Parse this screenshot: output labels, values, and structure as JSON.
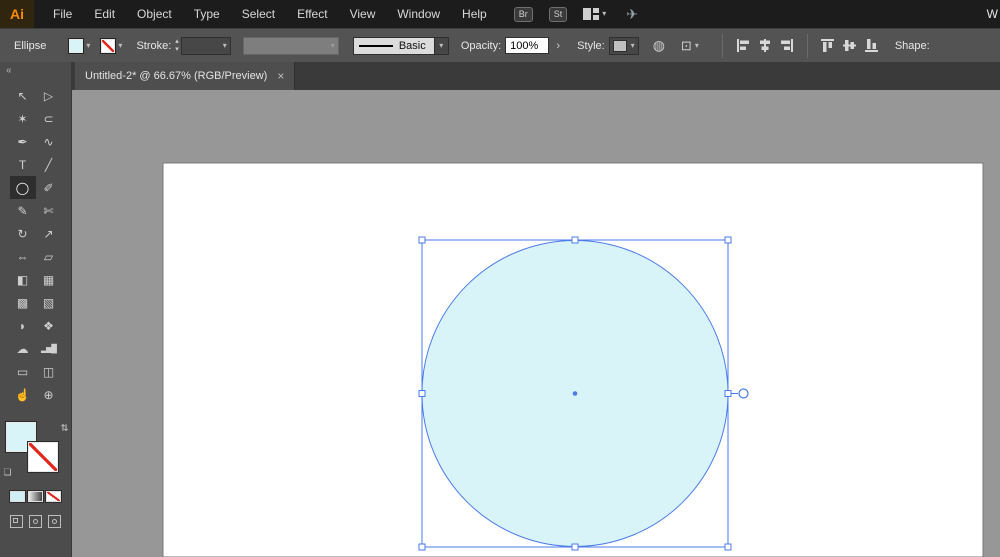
{
  "colors": {
    "accent_fill": "#d9f4f9",
    "selection_blue": "#4b7bec",
    "stroke_none_red": "#e0281c"
  },
  "menubar": {
    "logo": "Ai",
    "items": [
      "File",
      "Edit",
      "Object",
      "Type",
      "Select",
      "Effect",
      "View",
      "Window",
      "Help"
    ],
    "bridge_button": "Br",
    "stock_button": "St",
    "right_partial": "W"
  },
  "controlbar": {
    "tool_name": "Ellipse",
    "stroke_label": "Stroke:",
    "stroke_width_value": "",
    "brush_value": "Basic",
    "opacity_label": "Opacity:",
    "opacity_value": "100%",
    "style_label": "Style:",
    "shape_label": "Shape:"
  },
  "tabbar": {
    "title": "Untitled-2* @ 66.67% (RGB/Preview)",
    "close": "×"
  },
  "toolbar": {
    "collapse": "«",
    "tools": [
      {
        "name": "selection",
        "glyph": "↖"
      },
      {
        "name": "direct-selection",
        "glyph": "▷"
      },
      {
        "name": "magic-wand",
        "glyph": "✶"
      },
      {
        "name": "lasso",
        "glyph": "⊂"
      },
      {
        "name": "pen",
        "glyph": "✒"
      },
      {
        "name": "curvature",
        "glyph": "∿"
      },
      {
        "name": "type",
        "glyph": "T"
      },
      {
        "name": "line-segment",
        "glyph": "╱"
      },
      {
        "name": "ellipse",
        "glyph": "◯"
      },
      {
        "name": "paintbrush",
        "glyph": "✐"
      },
      {
        "name": "pencil",
        "glyph": "✎"
      },
      {
        "name": "scissors",
        "glyph": "✄"
      },
      {
        "name": "rotate",
        "glyph": "↻"
      },
      {
        "name": "scale",
        "glyph": "↗"
      },
      {
        "name": "width",
        "glyph": "⇔"
      },
      {
        "name": "free-transform",
        "glyph": "▱"
      },
      {
        "name": "shape-builder",
        "glyph": "◧"
      },
      {
        "name": "perspective-grid",
        "glyph": "▦"
      },
      {
        "name": "mesh",
        "glyph": "▩"
      },
      {
        "name": "gradient",
        "glyph": "▧"
      },
      {
        "name": "eyedropper",
        "glyph": "◗"
      },
      {
        "name": "blend",
        "glyph": "❖"
      },
      {
        "name": "symbol-sprayer",
        "glyph": "☁"
      },
      {
        "name": "column-graph",
        "glyph": "▂▅█"
      },
      {
        "name": "artboard",
        "glyph": "▭"
      },
      {
        "name": "slice",
        "glyph": "◫"
      },
      {
        "name": "hand",
        "glyph": "☝"
      },
      {
        "name": "zoom",
        "glyph": "⊕"
      }
    ]
  },
  "icons": {
    "caret": "▾",
    "stepper_up": "▴",
    "stepper_down": "▾",
    "chevron_right": "›",
    "swap": "⇄",
    "globe": "◍",
    "transform": "⊡",
    "share": "✈",
    "mini_default": "❏"
  },
  "canvas": {
    "selected_shape": {
      "type": "ellipse",
      "fill": "#d9f4f9",
      "stroke": "none"
    }
  }
}
